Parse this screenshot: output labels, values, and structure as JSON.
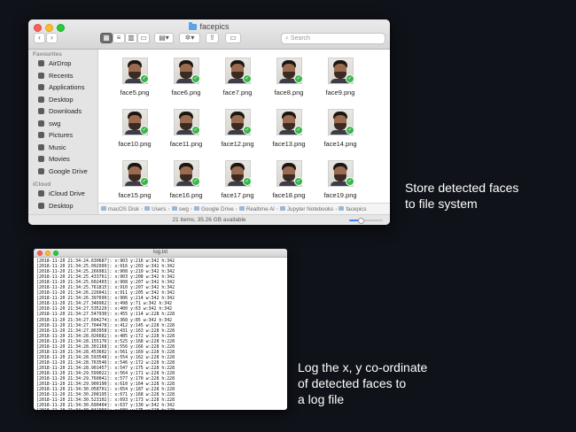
{
  "finder": {
    "title": "facepics",
    "search_placeholder": "Search",
    "sidebar": {
      "favourites_label": "Favourites",
      "favourites": [
        {
          "label": "AirDrop",
          "icon": "airdrop-icon"
        },
        {
          "label": "Recents",
          "icon": "clock-icon"
        },
        {
          "label": "Applications",
          "icon": "applications-icon"
        },
        {
          "label": "Desktop",
          "icon": "desktop-icon"
        },
        {
          "label": "Downloads",
          "icon": "download-icon"
        },
        {
          "label": "swg",
          "icon": "home-icon"
        },
        {
          "label": "Pictures",
          "icon": "camera-icon"
        },
        {
          "label": "Music",
          "icon": "music-note-icon"
        },
        {
          "label": "Movies",
          "icon": "film-icon"
        },
        {
          "label": "Google Drive",
          "icon": "drive-icon"
        }
      ],
      "icloud_label": "iCloud",
      "icloud": [
        {
          "label": "iCloud Drive",
          "icon": "cloud-icon"
        },
        {
          "label": "Desktop",
          "icon": "desktop-icon"
        }
      ]
    },
    "files": [
      "face5.png",
      "face6.png",
      "face7.png",
      "face8.png",
      "face9.png",
      "face10.png",
      "face11.png",
      "face12.png",
      "face13.png",
      "face14.png",
      "face15.png",
      "face16.png",
      "face17.png",
      "face18.png",
      "face19.png"
    ],
    "path": [
      "macOS Disk",
      "Users",
      "swg",
      "Google Drive",
      "Realtime Al",
      "Jupyter Notebooks",
      "facepics"
    ],
    "status": "21 items, 35.26 GB available",
    "icon_size_level": 0.35
  },
  "log": {
    "title": "log.txt",
    "lines": [
      "[2018-11-20 21:34:24.630687]: x:903 y:216 w:342 h:342",
      "[2018-11-20 21:34:25.092999]: x:916 y:203 w:342 h:342",
      "[2018-11-20 21:34:25.266981]: x:908 y:210 w:342 h:342",
      "[2018-11-20 21:34:25.433761]: x:903 y:208 w:342 h:342",
      "[2018-11-20 21:34:25.602403]: x:908 y:207 w:342 h:342",
      "[2018-11-20 21:34:25.761815]: x:910 y:207 w:342 h:342",
      "[2018-11-20 21:34:26.226041]: x:911 y:205 w:342 h:342",
      "[2018-11-20 21:34:26.397699]: x:906 y:214 w:342 h:342",
      "[2018-11-20 21:34:27.346962]: x:498 y:71 w:342 h:342",
      "[2018-11-20 21:34:27.535229]: x:400 y:63 w:342 h:342",
      "[2018-11-20 21:34:27.547930]: x:455 y:114 w:228 h:228",
      "[2018-11-20 21:34:27.694274]: x:368 y:85 w:342 h:342",
      "[2018-11-20 21:34:27.704478]: x:412 y:145 w:228 h:228",
      "[2018-11-20 21:34:27.863958]: x:431 y:163 w:228 h:228",
      "[2018-11-20 21:34:28.026682]: x:485 y:172 w:228 h:228",
      "[2018-11-20 21:34:28.155176]: x:525 y:168 w:228 h:228",
      "[2018-11-20 21:34:28.301168]: x:556 y:166 w:228 h:228",
      "[2018-11-20 21:34:28.453602]: x:561 y:169 w:228 h:228",
      "[2018-11-20 21:34:28.593548]: x:554 y:162 w:228 h:228",
      "[2018-11-20 21:34:28.763546]: x:546 y:172 w:228 h:228",
      "[2018-11-20 21:34:28.901457]: x:547 y:175 w:228 h:228",
      "[2018-11-20 21:34:29.599022]: x:564 y:171 w:228 h:228",
      "[2018-11-20 21:34:29.760041]: x:577 y:170 w:228 h:228",
      "[2018-11-20 21:34:29.900190]: x:610 y:164 w:228 h:228",
      "[2018-11-20 21:34:30.058701]: x:654 y:187 w:228 h:228",
      "[2018-11-20 21:34:30.208195]: x:671 y:168 w:228 h:228",
      "[2018-11-20 21:34:30.523102]: x:693 y:173 w:228 h:228",
      "[2018-11-20 21:34:30.690404]: x:637 y:130 w:342 h:342",
      "[2018-11-20 21:34:30.841969]: x:689 y:175 w:228 h:228",
      "[2018-11-20 21:34:30.994315]: x:640 y:129 w:342 h:342"
    ]
  },
  "captions": {
    "store": [
      "Store detected faces",
      "to file system"
    ],
    "log": [
      "Log the x, y co-ordinate",
      "of detected faces to",
      "a log file"
    ]
  },
  "colors": {
    "background": "#0f1218",
    "check_badge": "#39b54a",
    "folder_blue": "#5aa3e8"
  }
}
